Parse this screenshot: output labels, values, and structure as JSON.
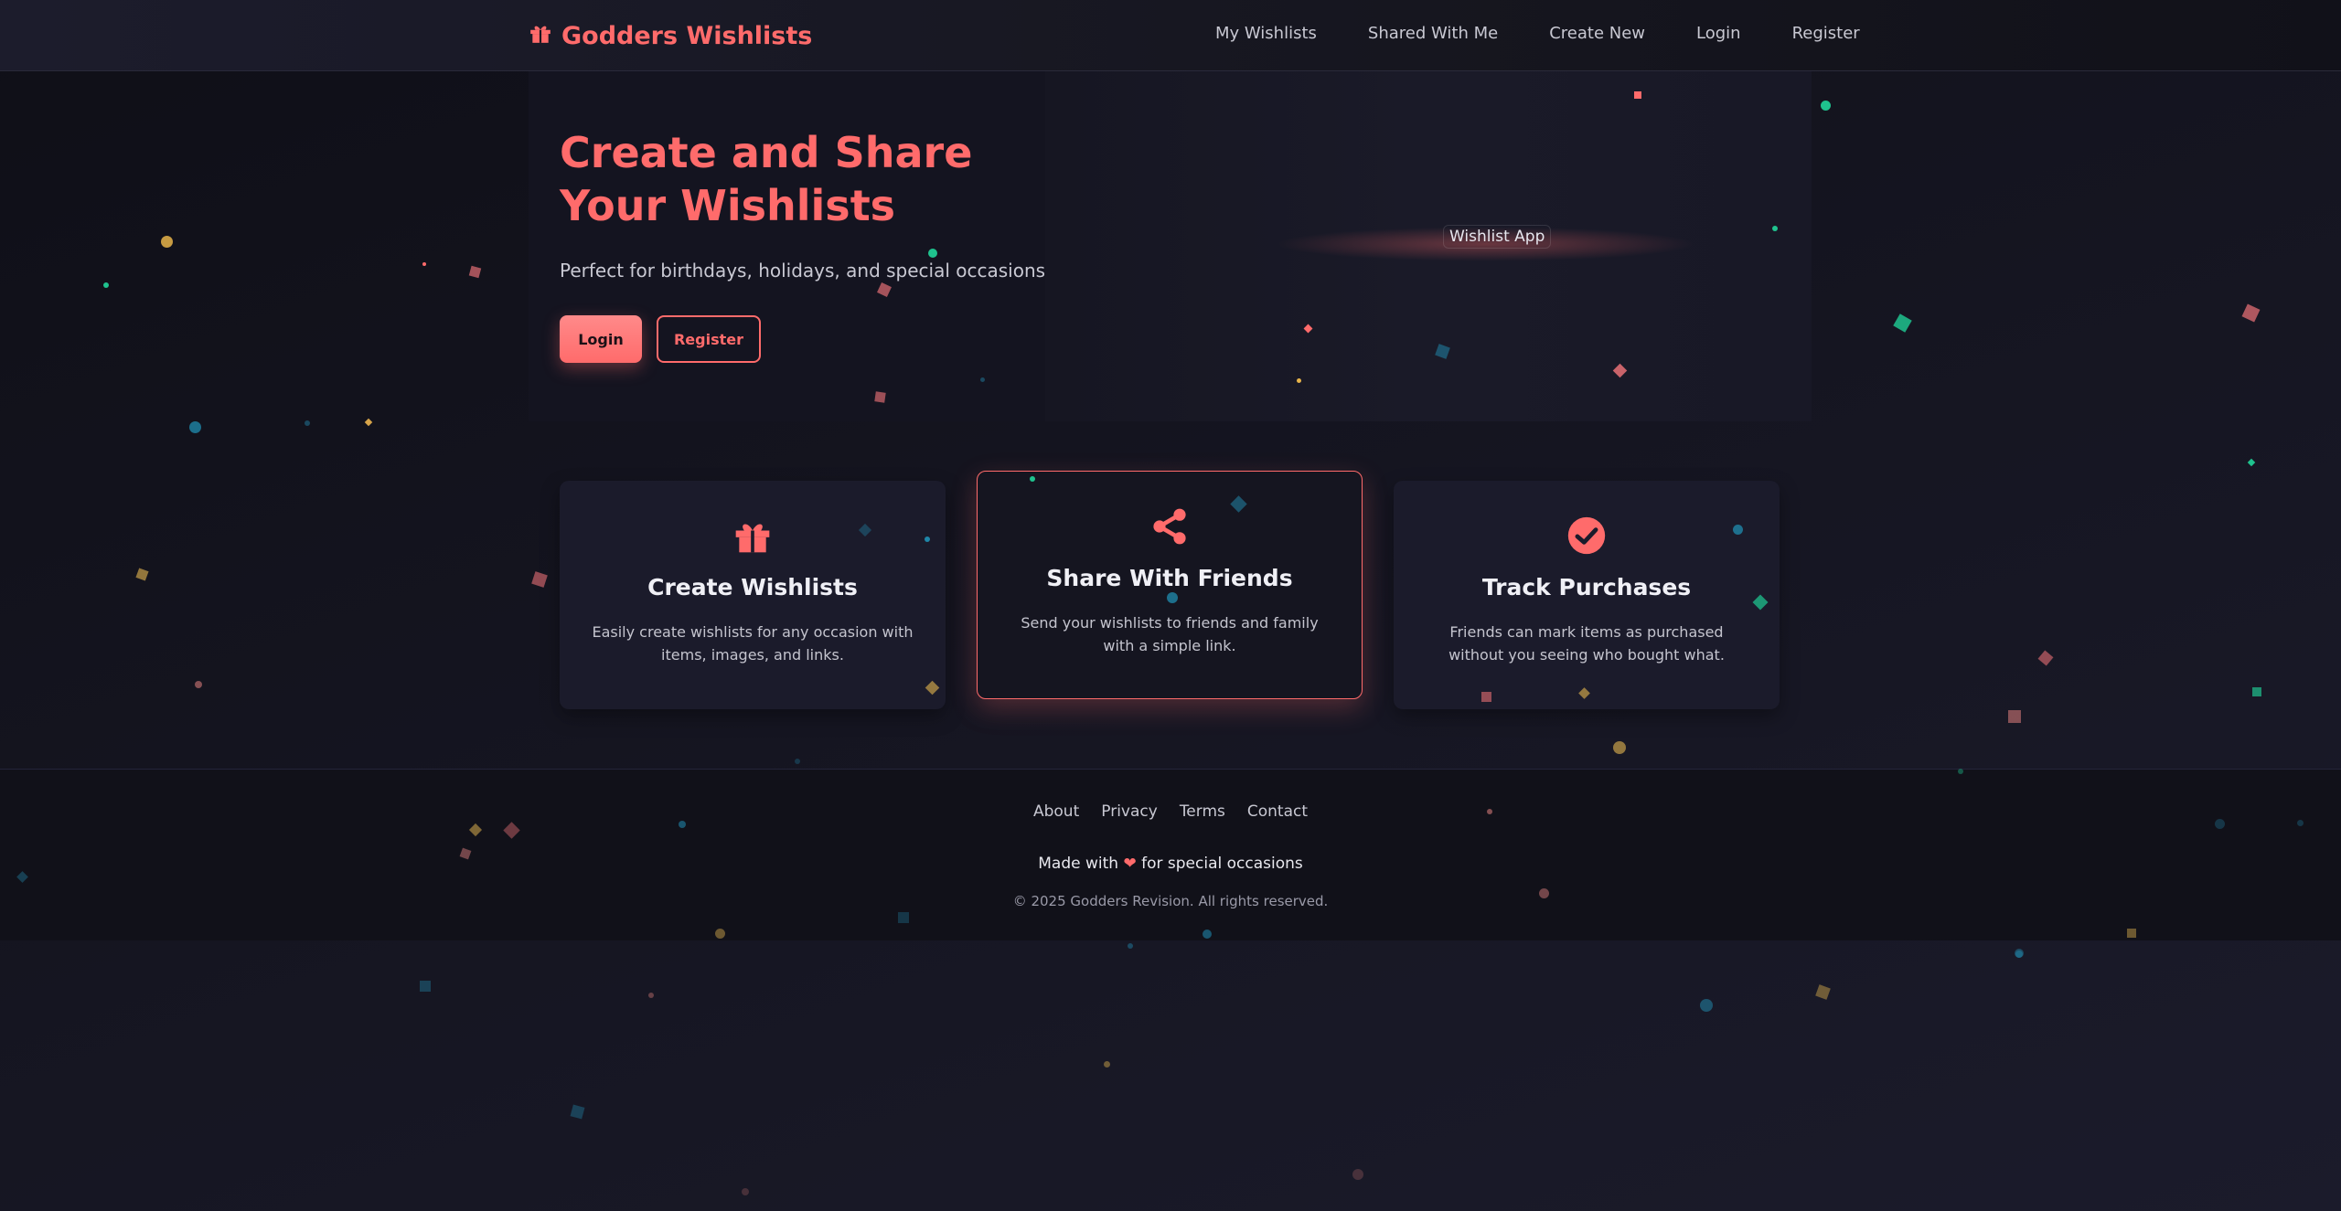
{
  "nav": {
    "brand": "Godders Wishlists",
    "links": [
      "My Wishlists",
      "Shared With Me",
      "Create New",
      "Login",
      "Register"
    ]
  },
  "hero": {
    "title": "Create and Share Your Wishlists",
    "subtitle": "Perfect for birthdays, holidays, and special occasions",
    "login_label": "Login",
    "register_label": "Register",
    "app_badge": "Wishlist App"
  },
  "features": [
    {
      "icon": "gift-icon",
      "title": "Create Wishlists",
      "text": "Easily create wishlists for any occasion with items, images, and links."
    },
    {
      "icon": "share-icon",
      "title": "Share With Friends",
      "text": "Send your wishlists to friends and family with a simple link."
    },
    {
      "icon": "check-circle-icon",
      "title": "Track Purchases",
      "text": "Friends can mark items as purchased without you seeing who bought what."
    }
  ],
  "footer": {
    "links": [
      "About",
      "Privacy",
      "Terms",
      "Contact"
    ],
    "made_prefix": "Made with",
    "heart": "❤",
    "made_suffix": "for special occasions",
    "copyright": "© 2025 Godders Revision. All rights reserved."
  },
  "colors": {
    "accent": "#ff6b6b",
    "background": "#14141f",
    "card": "#1b1b2b"
  }
}
